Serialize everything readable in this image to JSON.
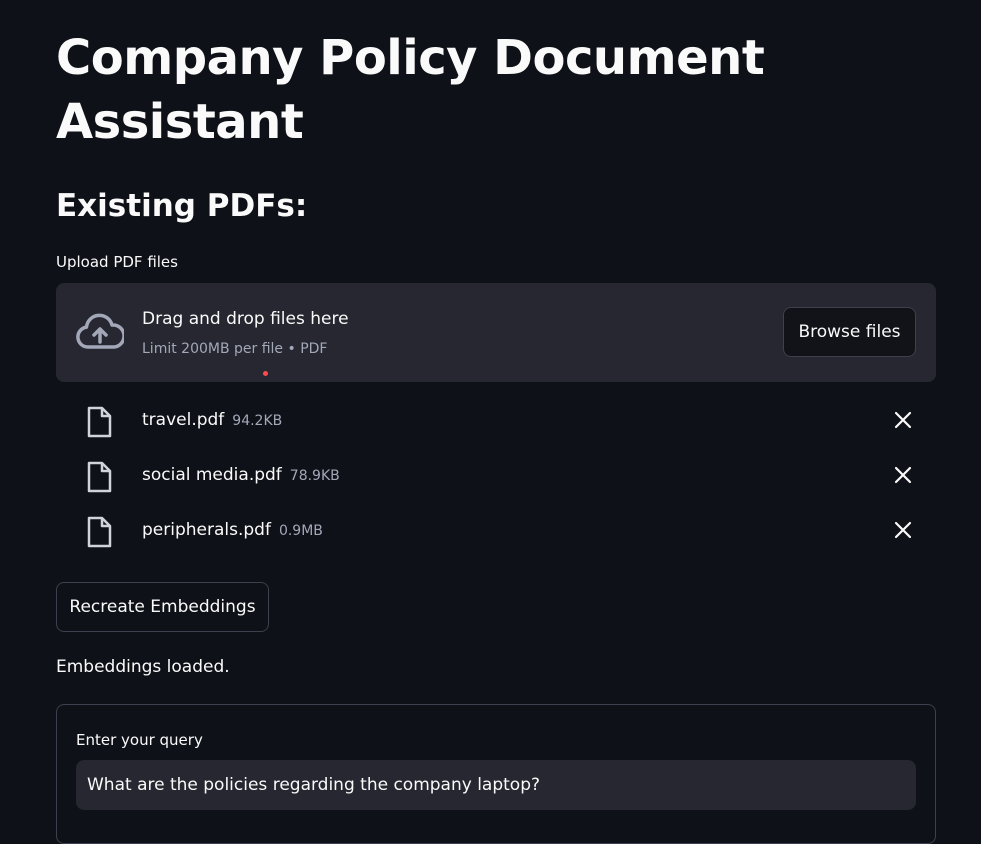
{
  "page": {
    "title": "Company Policy Document Assistant",
    "subtitle": "Existing PDFs:"
  },
  "uploader": {
    "label": "Upload PDF files",
    "drop_text": "Drag and drop files here",
    "limit_text": "Limit 200MB per file • PDF",
    "browse_label": "Browse files",
    "icon": "cloud-upload-icon"
  },
  "files": [
    {
      "name": "travel.pdf",
      "size": "94.2KB"
    },
    {
      "name": "social media.pdf",
      "size": "78.9KB"
    },
    {
      "name": "peripherals.pdf",
      "size": "0.9MB"
    }
  ],
  "actions": {
    "recreate_label": "Recreate Embeddings"
  },
  "status": {
    "text": "Embeddings loaded."
  },
  "query": {
    "label": "Enter your query",
    "value": "What are the policies regarding the company laptop?"
  },
  "colors": {
    "background": "#0e1117",
    "surface": "#262730",
    "border": "#3d404d",
    "text": "#fafafa",
    "muted": "#a3a8b8",
    "accent": "#ff4b4b"
  }
}
